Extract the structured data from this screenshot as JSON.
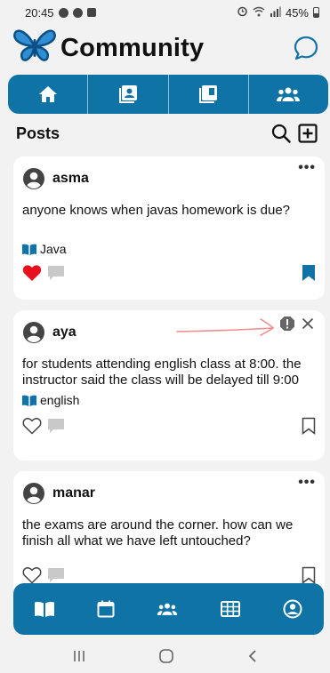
{
  "status": {
    "time": "20:45",
    "battery": "45%"
  },
  "header": {
    "title": "Community"
  },
  "tabs": [
    {
      "name": "home",
      "icon": "home-icon"
    },
    {
      "name": "profile",
      "icon": "contact-card-icon"
    },
    {
      "name": "library",
      "icon": "library-icon"
    },
    {
      "name": "groups",
      "icon": "group-icon"
    }
  ],
  "posts_bar": {
    "title": "Posts"
  },
  "posts": [
    {
      "user": "asma",
      "text": "anyone knows when javas homework is due?",
      "course": "Java",
      "liked": true,
      "bookmarked": true,
      "more": "•••"
    },
    {
      "user": "aya",
      "text": "for students attending english class at 8:00. the instructor said the class will be delayed till 9:00",
      "course": "english",
      "liked": false,
      "bookmarked": false
    },
    {
      "user": "manar",
      "text": "the exams are around the corner. how can we finish all what we have left untouched?",
      "liked": false,
      "bookmarked": false,
      "more": "•••"
    }
  ],
  "colors": {
    "primary": "#1073a6",
    "heart": "#e8101e",
    "annotation": "#f08d8d"
  },
  "bottom_nav": [
    "book-icon",
    "calendar-icon",
    "group-icon",
    "grid-icon",
    "account-icon"
  ]
}
